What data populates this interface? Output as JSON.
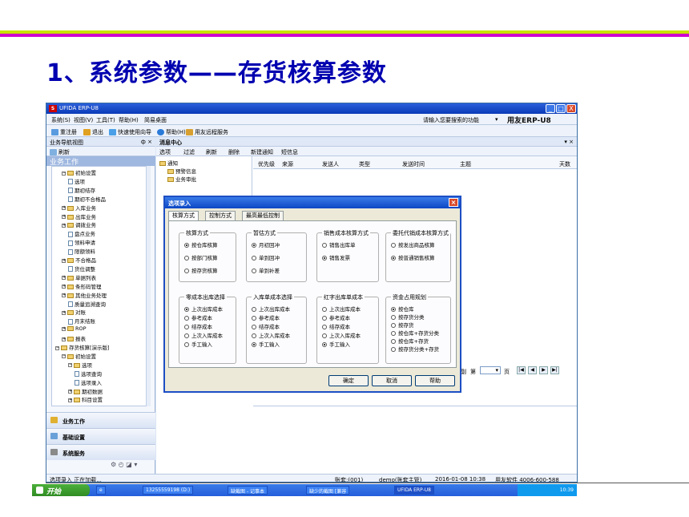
{
  "slide": {
    "title": "1、系统参数——存货核算参数"
  },
  "window": {
    "title": "UFIDA ERP-U8",
    "controls": {
      "minimize": "_",
      "maximize": "□",
      "close": "X"
    },
    "menu": [
      "系统(S)",
      "视图(V)",
      "工具(T)",
      "帮助(H)",
      "简易桌面"
    ],
    "search_hint": "请输入您要搜索的功能",
    "brand": "用友ERP-U8"
  },
  "toolbar": [
    "重注册",
    "退出",
    "快速使用向导",
    "帮助(H)",
    "用友远程服务"
  ],
  "nav": {
    "header": "业务导航视图",
    "pin": "ф ×",
    "refresh": "刷新",
    "section": "业务工作",
    "tree": [
      {
        "label": "初始设置",
        "level": 1,
        "kind": "folder-open",
        "toggle": "−"
      },
      {
        "label": "选项",
        "level": 2,
        "kind": "doc"
      },
      {
        "label": "期初结存",
        "level": 2,
        "kind": "doc"
      },
      {
        "label": "期初不合格品",
        "level": 2,
        "kind": "doc"
      },
      {
        "label": "入库业务",
        "level": 1,
        "kind": "folder",
        "toggle": "+"
      },
      {
        "label": "出库业务",
        "level": 1,
        "kind": "folder",
        "toggle": "+"
      },
      {
        "label": "调拨业务",
        "level": 1,
        "kind": "folder",
        "toggle": "+"
      },
      {
        "label": "盘点业务",
        "level": 2,
        "kind": "doc"
      },
      {
        "label": "领料申请",
        "level": 2,
        "kind": "doc"
      },
      {
        "label": "限额领料",
        "level": 2,
        "kind": "doc"
      },
      {
        "label": "不合格品",
        "level": 1,
        "kind": "folder",
        "toggle": "+"
      },
      {
        "label": "货位调整",
        "level": 2,
        "kind": "doc"
      },
      {
        "label": "单据列表",
        "level": 1,
        "kind": "folder",
        "toggle": "+"
      },
      {
        "label": "条形码管理",
        "level": 1,
        "kind": "folder",
        "toggle": "+"
      },
      {
        "label": "其他业务处理",
        "level": 1,
        "kind": "folder",
        "toggle": "+"
      },
      {
        "label": "质量追溯查询",
        "level": 2,
        "kind": "doc"
      },
      {
        "label": "对账",
        "level": 1,
        "kind": "folder",
        "toggle": "+"
      },
      {
        "label": "月末结账",
        "level": 2,
        "kind": "doc"
      },
      {
        "label": "ROP",
        "level": 1,
        "kind": "folder",
        "toggle": "+"
      },
      {
        "label": "报表",
        "level": 1,
        "kind": "folder",
        "toggle": "+"
      },
      {
        "label": "存货核算[演示版]",
        "level": 0,
        "kind": "folder-open",
        "toggle": "−"
      },
      {
        "label": "初始设置",
        "level": 1,
        "kind": "folder-open",
        "toggle": "−"
      },
      {
        "label": "选项",
        "level": 2,
        "kind": "folder-open",
        "toggle": "−"
      },
      {
        "label": "选项查询",
        "level": 3,
        "kind": "doc"
      },
      {
        "label": "选项录入",
        "level": 3,
        "kind": "doc"
      },
      {
        "label": "期初数据",
        "level": 2,
        "kind": "folder",
        "toggle": "+"
      },
      {
        "label": "科目设置",
        "level": 2,
        "kind": "folder",
        "toggle": "+"
      }
    ],
    "buttons": [
      "业务工作",
      "基础设置",
      "系统服务"
    ]
  },
  "message_center": {
    "title": "消息中心",
    "close": "▾ ×",
    "tools": [
      "选项",
      "过滤",
      "刷新",
      "删除",
      "新建通知",
      "短信息"
    ],
    "tree": [
      {
        "label": "通知",
        "level": 0
      },
      {
        "label": "预警信息",
        "level": 1
      },
      {
        "label": "业务审批",
        "level": 1
      }
    ],
    "columns": [
      "优先级",
      "来源",
      "发送人",
      "类型",
      "发送时间",
      "主题",
      "天数"
    ],
    "pager": {
      "label_page": "第",
      "label_page2": "页",
      "current": "1",
      "prefix": "副"
    }
  },
  "dialog": {
    "title": "选项录入",
    "tabs": [
      "核算方式",
      "控制方式",
      "最高最低控制"
    ],
    "groups": [
      {
        "title": "核算方式",
        "options": [
          {
            "label": "按仓库核算",
            "on": true
          },
          {
            "label": "按部门核算",
            "on": false
          },
          {
            "label": "按存货核算",
            "on": false
          }
        ]
      },
      {
        "title": "暂估方式",
        "options": [
          {
            "label": "月初回冲",
            "on": true
          },
          {
            "label": "单到回冲",
            "on": false
          },
          {
            "label": "单到补差",
            "on": false
          }
        ]
      },
      {
        "title": "销售成本核算方式",
        "options": [
          {
            "label": "销售出库单",
            "on": false
          },
          {
            "label": "销售发票",
            "on": true
          }
        ]
      },
      {
        "title": "委托代销成本核算方式",
        "options": [
          {
            "label": "按发出商品核算",
            "on": false
          },
          {
            "label": "按普通销售核算",
            "on": true
          }
        ]
      },
      {
        "title": "零成本出库选择",
        "options": [
          {
            "label": "上次出库成本",
            "on": true
          },
          {
            "label": "参考成本",
            "on": false
          },
          {
            "label": "结存成本",
            "on": false
          },
          {
            "label": "上次入库成本",
            "on": false
          },
          {
            "label": "手工输入",
            "on": false
          }
        ]
      },
      {
        "title": "入库单成本选择",
        "options": [
          {
            "label": "上次出库成本",
            "on": false
          },
          {
            "label": "参考成本",
            "on": false
          },
          {
            "label": "结存成本",
            "on": false
          },
          {
            "label": "上次入库成本",
            "on": false
          },
          {
            "label": "手工输入",
            "on": true
          }
        ]
      },
      {
        "title": "红字出库单成本",
        "options": [
          {
            "label": "上次出库成本",
            "on": false
          },
          {
            "label": "参考成本",
            "on": false
          },
          {
            "label": "结存成本",
            "on": false
          },
          {
            "label": "上次入库成本",
            "on": false
          },
          {
            "label": "手工输入",
            "on": true
          }
        ]
      },
      {
        "title": "资金占用规划",
        "options": [
          {
            "label": "按仓库",
            "on": true
          },
          {
            "label": "按存货分类",
            "on": false
          },
          {
            "label": "按存货",
            "on": false
          },
          {
            "label": "按仓库+存货分类",
            "on": false
          },
          {
            "label": "按仓库+存货",
            "on": false
          },
          {
            "label": "按存货分类+存货",
            "on": false
          }
        ]
      }
    ],
    "buttons": {
      "ok": "确定",
      "cancel": "取消",
      "help": "帮助"
    }
  },
  "status": {
    "left": "选项录入 正在加载...",
    "account": "账套:(001)",
    "user": "demo(账套主管)",
    "datetime": "2016-01-08 10:38",
    "hotline": "用友软件 4006-600-588"
  },
  "taskbar": {
    "start": "开始",
    "tasks": [
      "13255559198 (D:)",
      "缺截图 - 记事本",
      "缺少的截图 [兼容",
      "UFIDA ERP-U8"
    ],
    "clock": "10:39"
  },
  "colors": {
    "title_blue": "#0000b0",
    "bar_green": "#c8e000",
    "bar_magenta": "#d000d0"
  }
}
